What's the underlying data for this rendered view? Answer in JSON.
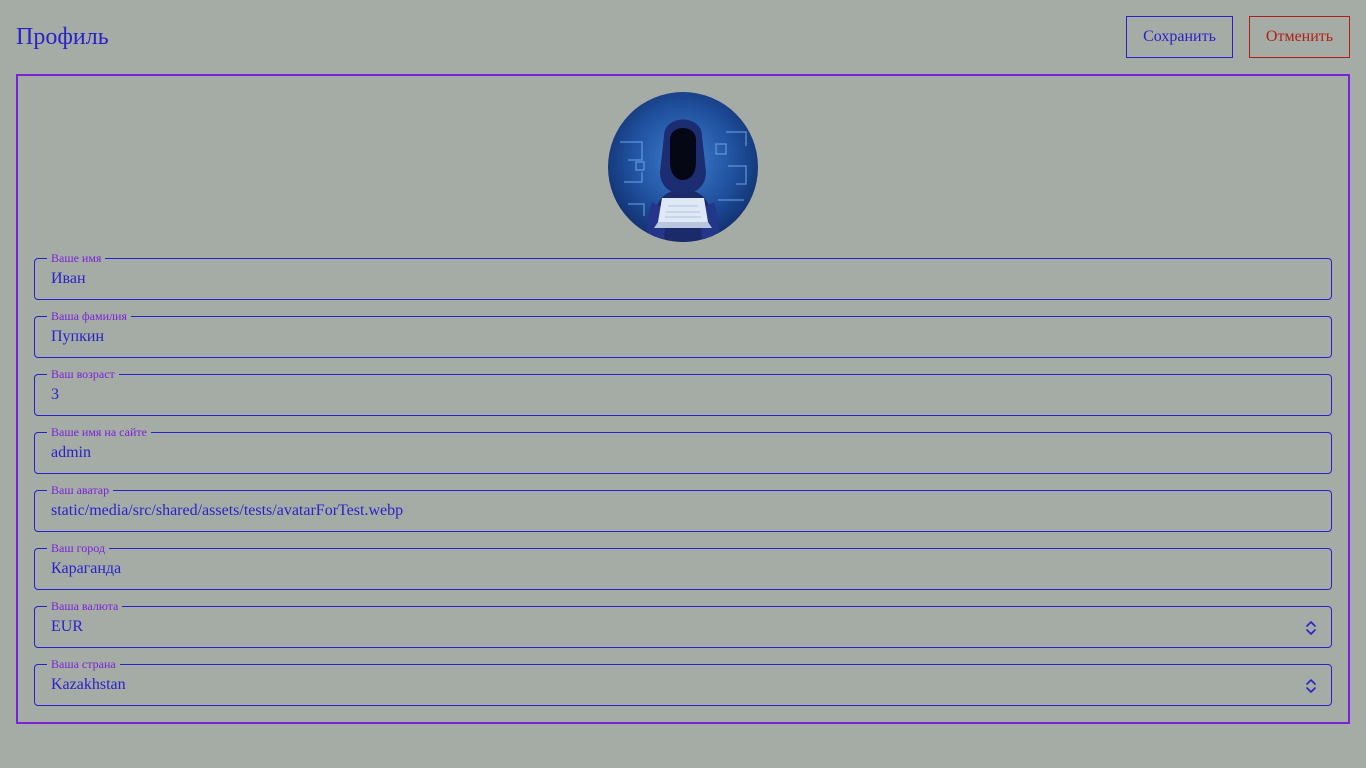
{
  "header": {
    "title": "Профиль",
    "save_label": "Сохранить",
    "cancel_label": "Отменить"
  },
  "profile": {
    "avatar_icon": "hacker-avatar-image",
    "fields": [
      {
        "label": "Ваше имя",
        "value": "Иван"
      },
      {
        "label": "Ваша фамилия",
        "value": "Пупкин"
      },
      {
        "label": "Ваш возраст",
        "value": "3"
      },
      {
        "label": "Ваше имя на сайте",
        "value": "admin"
      },
      {
        "label": "Ваш аватар",
        "value": "static/media/src/shared/assets/tests/avatarForTest.webp"
      },
      {
        "label": "Ваш город",
        "value": "Караганда"
      },
      {
        "label": "Ваша валюта",
        "value": "EUR"
      },
      {
        "label": "Ваша страна",
        "value": "Kazakhstan"
      }
    ]
  },
  "colors": {
    "background": "#a5aca6",
    "primary": "#2a22c8",
    "accent": "#7a22d8",
    "danger": "#b0201a"
  }
}
